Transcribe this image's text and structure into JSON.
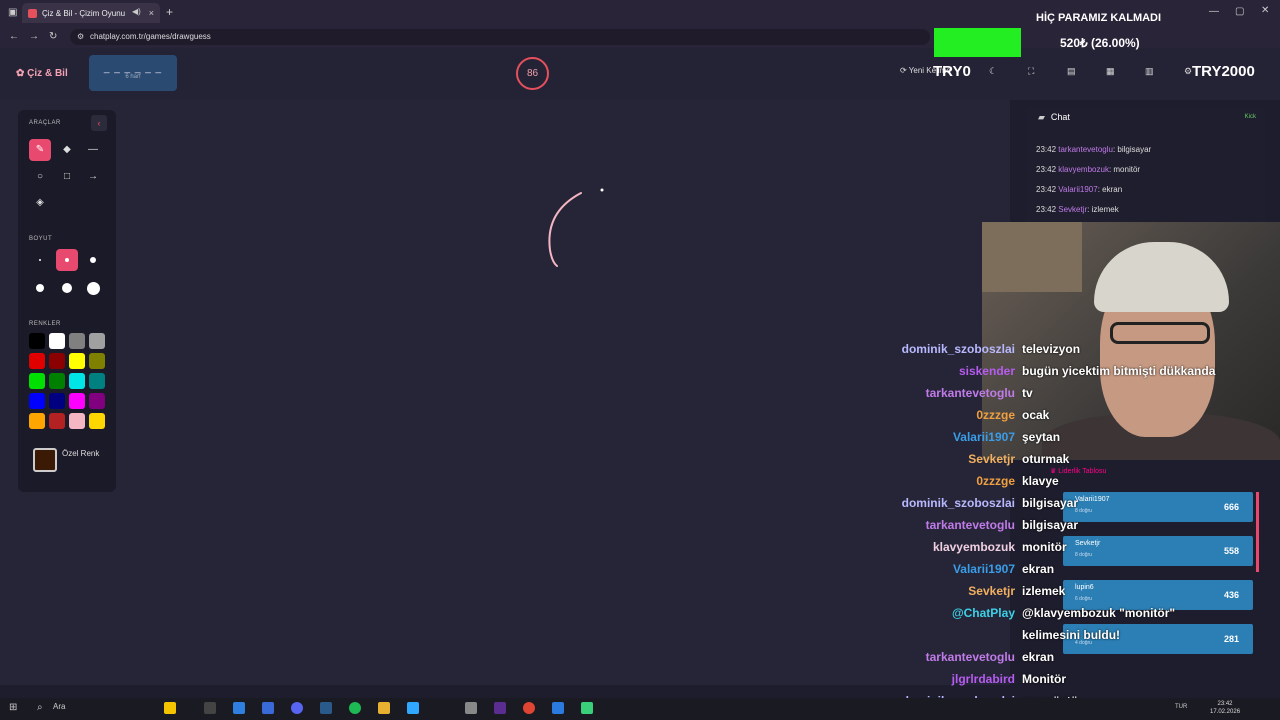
{
  "browser": {
    "tab_title": "Çiz & Bil - Çizim Oyunu",
    "tab_close": "×",
    "new_tab": "+",
    "url": "chatplay.com.tr/games/drawguess"
  },
  "overlay": {
    "banner": "HİÇ PARAMIZ KALMADI",
    "money": "520₺ (26.00%)",
    "try_left": "TRY0",
    "try_right": "TRY2000",
    "progress_color": "#22ee22"
  },
  "header": {
    "logo": "Çiz & Bil",
    "word_blanks": "_ _ _ _ _ _",
    "word_length": "6 harf",
    "timer": "86",
    "new_word": "Yeni Kelime"
  },
  "tools": {
    "section_tools": "ARAÇLAR",
    "section_size": "BOYUT",
    "section_colors": "RENKLER",
    "custom_color_label": "Özel Renk",
    "custom_color": "#3b1a05",
    "colors": [
      "#000000",
      "#ffffff",
      "#808080",
      "#a0a0a0",
      "#e00000",
      "#8b0000",
      "#ffff00",
      "#808000",
      "#00e000",
      "#008000",
      "#00e5e5",
      "#008080",
      "#0000ff",
      "#000080",
      "#ff00ff",
      "#800080",
      "#ffa500",
      "#b22222",
      "#f4b6c2",
      "#ffd700"
    ]
  },
  "chat": {
    "title": "Chat",
    "kick": "Kick",
    "messages": [
      {
        "time": "23:42",
        "user": "tarkantevetoglu",
        "text": "bilgisayar"
      },
      {
        "time": "23:42",
        "user": "klavyembozuk",
        "text": "monitör"
      },
      {
        "time": "23:42",
        "user": "Valarii1907",
        "text": "ekran"
      },
      {
        "time": "23:42",
        "user": "Sevketjr",
        "text": "izlemek"
      }
    ]
  },
  "leaderboard": {
    "title": "Liderlik Tablosu",
    "rows": [
      {
        "name": "Valarii1907",
        "sub": "8 doğru",
        "score": "666"
      },
      {
        "name": "Sevketjr",
        "sub": "8 doğru",
        "score": "558"
      },
      {
        "name": "lupin6",
        "sub": "6 doğru",
        "score": "436"
      },
      {
        "name": "",
        "sub": "4 doğru",
        "score": "281"
      }
    ]
  },
  "stream_chat": [
    {
      "user": "dominik_szoboszlai",
      "text": "televizyon",
      "color": "#b8b8ff"
    },
    {
      "user": "siskender",
      "text": "bugün yicektim bitmişti dükkanda",
      "color": "#b65cf0"
    },
    {
      "user": "tarkantevetoglu",
      "text": "tv",
      "color": "#c07be8"
    },
    {
      "user": "0zzzge",
      "text": "ocak",
      "color": "#f0a040"
    },
    {
      "user": "Valarii1907",
      "text": "şeytan",
      "color": "#3a9de8"
    },
    {
      "user": "Sevketjr",
      "text": "oturmak",
      "color": "#f0b060"
    },
    {
      "user": "0zzzge",
      "text": "klavye",
      "color": "#f0a040"
    },
    {
      "user": "dominik_szoboszlai",
      "text": "bilgisayar",
      "color": "#b8b8ff"
    },
    {
      "user": "tarkantevetoglu",
      "text": "bilgisayar",
      "color": "#c07be8"
    },
    {
      "user": "klavyembozuk",
      "text": "monitör",
      "color": "#f0d0e0"
    },
    {
      "user": "Valarii1907",
      "text": "ekran",
      "color": "#3a9de8"
    },
    {
      "user": "Sevketjr",
      "text": "izlemek",
      "color": "#f0b060"
    },
    {
      "user": "@ChatPlay",
      "text": "@klavyembozuk \"monitör\"",
      "color": "#3cd0e8"
    },
    {
      "user": "",
      "text": "kelimesini buldu!",
      "color": "#ffffff"
    },
    {
      "user": "tarkantevetoglu",
      "text": "ekran",
      "color": "#c07be8"
    },
    {
      "user": "jlgrlrdabird",
      "text": "Monitör",
      "color": "#b65cf0"
    },
    {
      "user": "dominik_szoboszlai",
      "text": "masaüstü",
      "color": "#b8b8ff"
    }
  ],
  "taskbar": {
    "search": "Ara",
    "time": "23:42",
    "date": "17.02.2026",
    "lang": "TUR"
  }
}
